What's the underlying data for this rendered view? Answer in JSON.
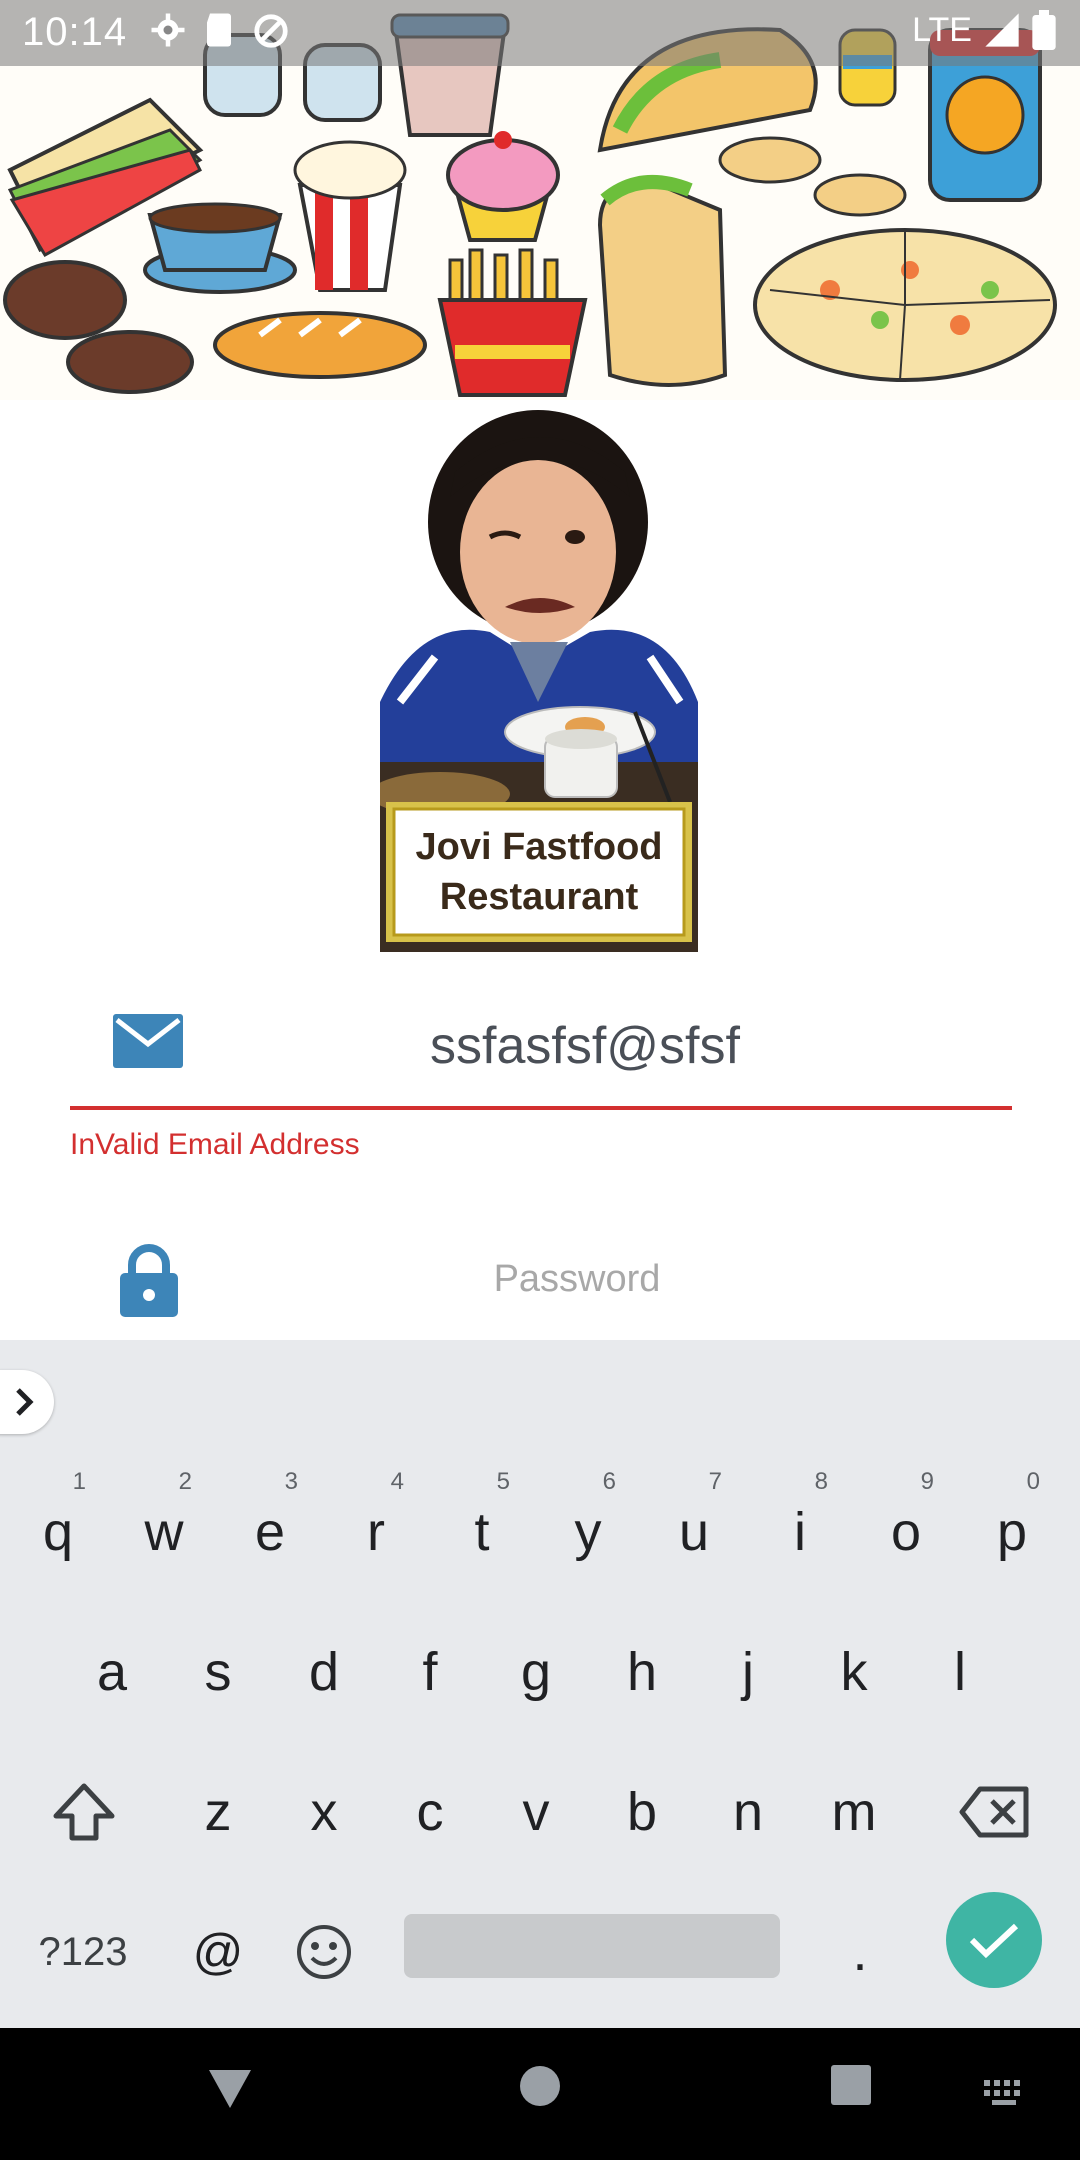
{
  "status_bar": {
    "time": "10:14",
    "network": "LTE",
    "icons": [
      "settings-icon",
      "sd-card-icon",
      "sync-icon",
      "signal-icon",
      "battery-icon"
    ]
  },
  "logo": {
    "line1": "Jovi Fastfood",
    "line2": "Restaurant"
  },
  "email_field": {
    "icon": "email-icon",
    "value": "ssfasfsf@sfsf",
    "error": "InValid Email Address"
  },
  "password_field": {
    "icon": "lock-icon",
    "placeholder": "Password"
  },
  "keyboard": {
    "row1": [
      {
        "k": "q",
        "n": "1"
      },
      {
        "k": "w",
        "n": "2"
      },
      {
        "k": "e",
        "n": "3"
      },
      {
        "k": "r",
        "n": "4"
      },
      {
        "k": "t",
        "n": "5"
      },
      {
        "k": "y",
        "n": "6"
      },
      {
        "k": "u",
        "n": "7"
      },
      {
        "k": "i",
        "n": "8"
      },
      {
        "k": "o",
        "n": "9"
      },
      {
        "k": "p",
        "n": "0"
      }
    ],
    "row2": [
      "a",
      "s",
      "d",
      "f",
      "g",
      "h",
      "j",
      "k",
      "l"
    ],
    "row3": [
      "z",
      "x",
      "c",
      "v",
      "b",
      "n",
      "m"
    ],
    "symbols_label": "?123",
    "at_label": "@",
    "period_label": "."
  },
  "colors": {
    "error": "#d32f2f",
    "icon_blue": "#3d85b8",
    "enter_teal": "#3fb5a4"
  }
}
